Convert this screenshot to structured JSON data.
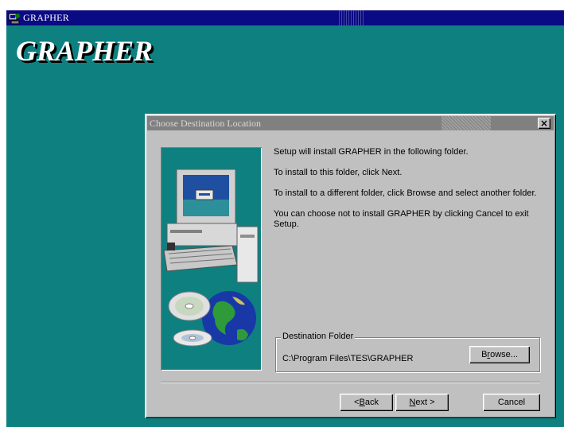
{
  "app": {
    "title": "GRAPHER",
    "banner": "GRAPHER",
    "background_color": "#0e8080",
    "titlebar_color": "#0a0a84"
  },
  "dialog": {
    "title": "Choose Destination Location",
    "close_label": "×",
    "instructions": [
      "Setup will install GRAPHER in the following folder.",
      "To install to this folder, click Next.",
      "To install to a different folder, click Browse and select another folder.",
      "You can choose not to install GRAPHER by clicking Cancel to exit Setup."
    ],
    "destination_group_label": "Destination Folder",
    "destination_path": "C:\\Program Files\\TES\\GRAPHER",
    "buttons": {
      "browse": {
        "pre": "B",
        "ul": "r",
        "post": "owse..."
      },
      "back": {
        "pre": "< ",
        "ul": "B",
        "post": "ack"
      },
      "next": {
        "pre": "",
        "ul": "N",
        "post": "ext >"
      },
      "cancel": "Cancel"
    },
    "illustration_icons": [
      "computer-icon",
      "cd-disc-icon",
      "globe-icon"
    ]
  }
}
